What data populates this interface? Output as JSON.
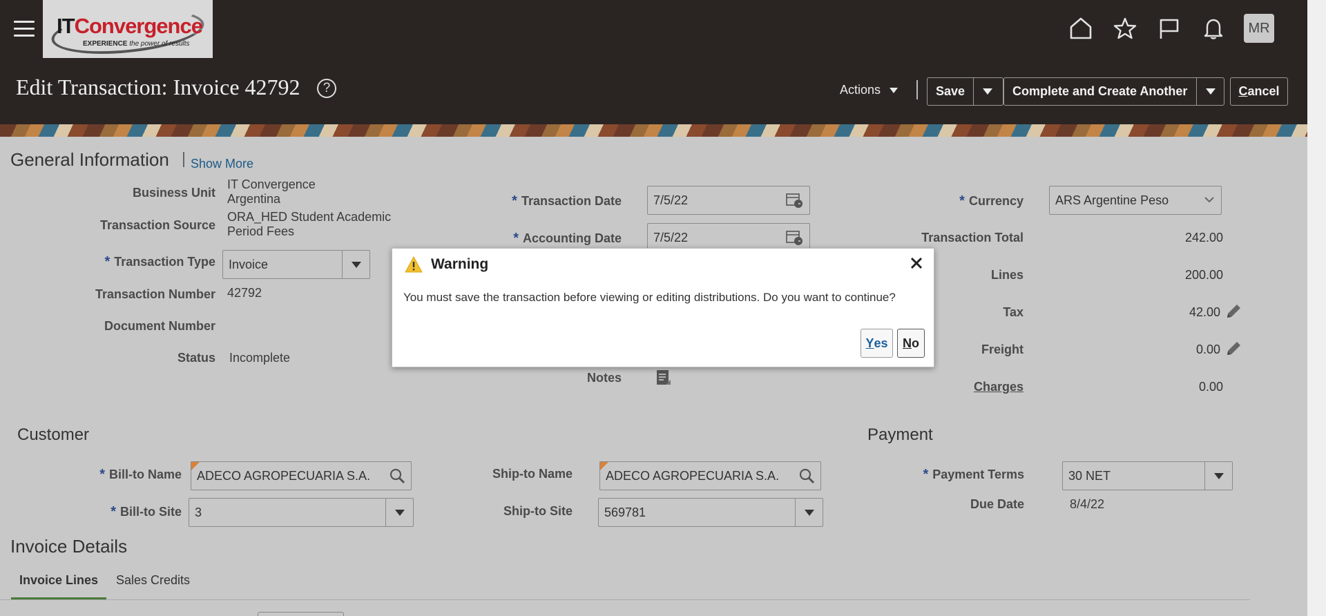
{
  "header": {
    "logo_text_it": "IT",
    "logo_text_brand": "Convergence",
    "logo_tag_bold": "EXPERIENCE",
    "logo_tag_rest": " the power of results",
    "avatar_initials": "MR",
    "page_title": "Edit Transaction: Invoice 42792",
    "actions_label": "Actions",
    "save_label": "Save",
    "complete_label": "Complete and Create Another",
    "cancel_label_first": "C",
    "cancel_label_rest": "ancel",
    "icons": [
      "menu-icon",
      "home-icon",
      "star-icon",
      "flag-icon",
      "bell-icon",
      "help-icon"
    ]
  },
  "general": {
    "heading": "General Information",
    "show_more": "Show More",
    "business_unit_label": "Business Unit",
    "business_unit_line1": "IT Convergence",
    "business_unit_line2": "Argentina",
    "transaction_source_label": "Transaction Source",
    "transaction_source_line1": "ORA_HED Student Academic",
    "transaction_source_line2": "Period Fees",
    "transaction_type_label": "Transaction Type",
    "transaction_type_value": "Invoice",
    "transaction_number_label": "Transaction Number",
    "transaction_number_value": "42792",
    "document_number_label": "Document Number",
    "status_label": "Status",
    "status_value": "Incomplete",
    "transaction_date_label": "Transaction Date",
    "transaction_date_value": "7/5/22",
    "accounting_date_label": "Accounting Date",
    "accounting_date_value": "7/5/22",
    "notes_label": "Notes",
    "currency_label": "Currency",
    "currency_value": "ARS Argentine Peso",
    "transaction_total_label": "Transaction Total",
    "transaction_total_value": "242.00",
    "lines_label": "Lines",
    "lines_value": "200.00",
    "tax_label": "Tax",
    "tax_value": "42.00",
    "freight_label": "Freight",
    "freight_value": "0.00",
    "charges_label": "Charges",
    "charges_value": "0.00",
    "required_marker": "*"
  },
  "customer": {
    "heading": "Customer",
    "bill_to_name_label": "Bill-to Name",
    "bill_to_name_value": "ADECO AGROPECUARIA S.A.",
    "bill_to_site_label": "Bill-to Site",
    "bill_to_site_value": "3",
    "ship_to_name_label": "Ship-to Name",
    "ship_to_name_value": "ADECO AGROPECUARIA S.A.",
    "ship_to_site_label": "Ship-to Site",
    "ship_to_site_value": "569781"
  },
  "payment": {
    "heading": "Payment",
    "payment_terms_label": "Payment Terms",
    "payment_terms_value": "30 NET",
    "due_date_label": "Due Date",
    "due_date_value": "8/4/22"
  },
  "invoice_details": {
    "heading": "Invoice Details",
    "tabs": [
      {
        "label": "Invoice Lines"
      },
      {
        "label": "Sales Credits"
      }
    ]
  },
  "dialog": {
    "title": "Warning",
    "message": "You must save the transaction before viewing or editing distributions. Do you want to continue?",
    "yes_first": "Y",
    "yes_rest": "es",
    "no_first": "N",
    "no_rest": "o"
  },
  "colors": {
    "header_bg": "#2a2522",
    "link": "#1c5a86",
    "required": "#2b4a8a",
    "warning": "#f2c12e",
    "tab_active_border": "#4a7a3a"
  }
}
